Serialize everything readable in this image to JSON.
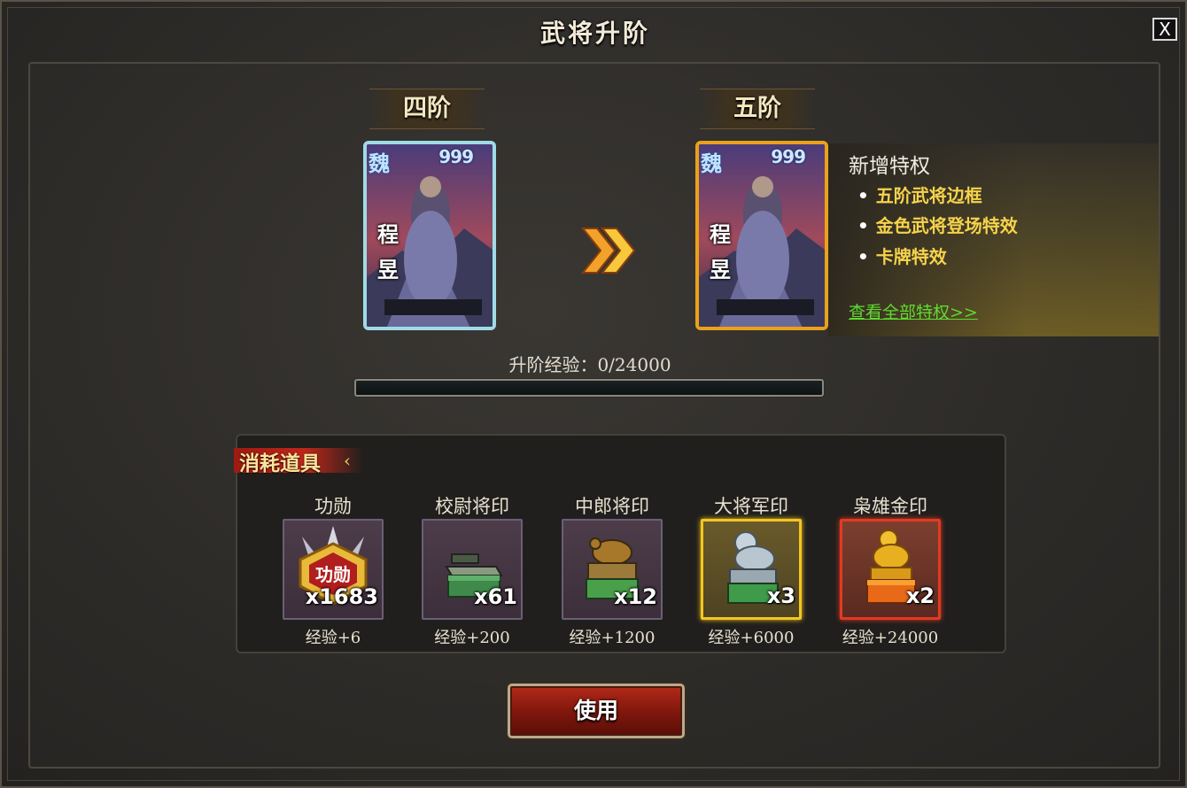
{
  "window": {
    "title": "武将升阶",
    "close_label": "X"
  },
  "current_rank": {
    "label": "四阶",
    "general_name": "程昱",
    "name_chars": [
      "程",
      "昱"
    ],
    "card_mark": "魏",
    "card_stars": "999",
    "frame_color": "#9fdbe6"
  },
  "next_rank": {
    "label": "五阶",
    "general_name": "程昱",
    "name_chars": [
      "程",
      "昱"
    ],
    "card_mark": "魏",
    "card_stars": "999",
    "frame_color": "#e9a21a"
  },
  "privileges": {
    "title": "新增特权",
    "items": [
      "五阶武将边框",
      "金色武将登场特效",
      "卡牌特效"
    ],
    "view_all_link": "查看全部特权>>"
  },
  "upgrade_exp": {
    "text": "升阶经验：0/24000",
    "current": 0,
    "max": 24000
  },
  "consumables": {
    "title": "消耗道具",
    "items": [
      {
        "name": "功勋",
        "count": "x1683",
        "exp": "经验+6",
        "icon": "merit-badge-icon",
        "state": "normal"
      },
      {
        "name": "校尉将印",
        "count": "x61",
        "exp": "经验+200",
        "icon": "green-seal-box-icon",
        "state": "normal"
      },
      {
        "name": "中郎将印",
        "count": "x12",
        "exp": "经验+1200",
        "icon": "bronze-turtle-seal-icon",
        "state": "normal"
      },
      {
        "name": "大将军印",
        "count": "x3",
        "exp": "经验+6000",
        "icon": "silver-lion-seal-icon",
        "state": "gold"
      },
      {
        "name": "枭雄金印",
        "count": "x2",
        "exp": "经验+24000",
        "icon": "gold-dragon-seal-icon",
        "state": "red"
      }
    ]
  },
  "actions": {
    "use_label": "使用"
  },
  "colors": {
    "privilege_item": "#f6d34b",
    "link": "#5fdb30",
    "button": "#9a1f12"
  }
}
